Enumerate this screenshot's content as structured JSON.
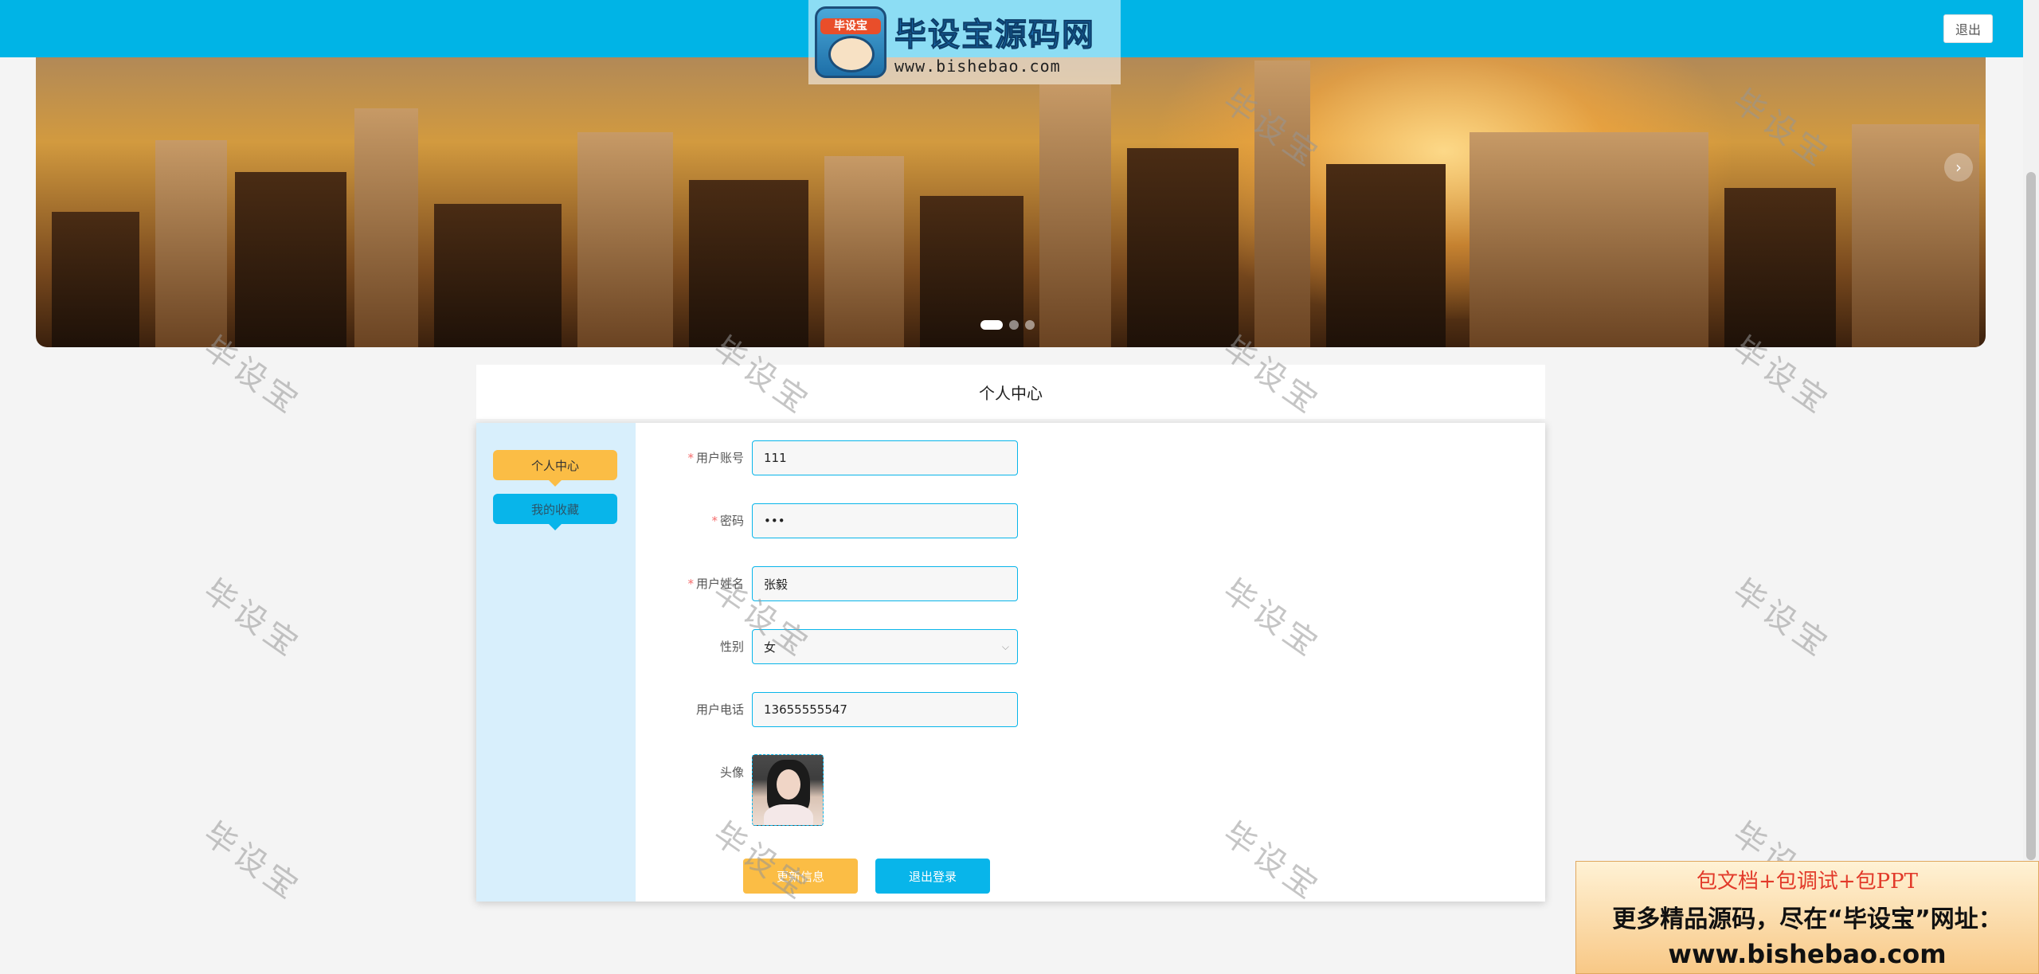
{
  "header": {
    "logout_label": "退出",
    "logo": {
      "name": "毕设宝源码网",
      "url": "www.bishebao.com",
      "mascot_text": "毕设宝"
    }
  },
  "banner": {
    "dots": [
      true,
      false,
      false
    ],
    "next_icon": "chevron-right-icon"
  },
  "page_title": "个人中心",
  "sidebar": {
    "items": [
      {
        "label": "个人中心",
        "active": true
      },
      {
        "label": "我的收藏",
        "active": false
      }
    ]
  },
  "form": {
    "account": {
      "label": "用户账号",
      "required": "*",
      "value": "111"
    },
    "password": {
      "label": "密码",
      "required": "*",
      "value": "•••"
    },
    "name": {
      "label": "用户姓名",
      "required": "*",
      "value": "张毅"
    },
    "gender": {
      "label": "性别",
      "value": "女",
      "arrow_icon": "chevron-down-icon"
    },
    "phone": {
      "label": "用户电话",
      "value": "13655555547"
    },
    "avatar": {
      "label": "头像"
    }
  },
  "actions": {
    "update_label": "更新信息",
    "logout_label": "退出登录"
  },
  "watermark": "毕设宝",
  "promo": {
    "line1": "包文档+包调试+包PPT",
    "line2": "更多精品源码，尽在“毕设宝”网址：",
    "line3": "www.bishebao.com"
  },
  "colors": {
    "primary": "#00b4e6",
    "accent": "#fbbd45",
    "sidebar_bg": "#d8effc",
    "required": "#f56c6c"
  }
}
